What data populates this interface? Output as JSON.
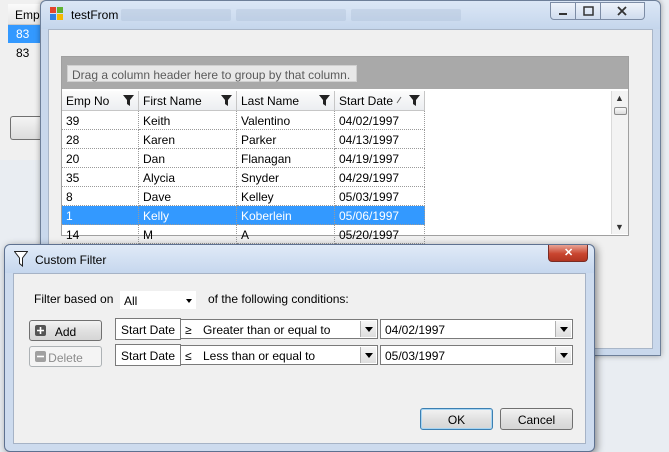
{
  "background_window": {
    "header": "Emp",
    "rows": [
      "83",
      "83"
    ]
  },
  "main_window": {
    "title": "testFrom",
    "grid": {
      "group_hint": "Drag a column header here to group by that column.",
      "columns": [
        "Emp No",
        "First Name",
        "Last Name",
        "Start Date"
      ],
      "rows": [
        [
          "39",
          "Keith",
          "Valentino",
          "04/02/1997"
        ],
        [
          "28",
          "Karen",
          "Parker",
          "04/13/1997"
        ],
        [
          "20",
          "Dan",
          "Flanagan",
          "04/19/1997"
        ],
        [
          "35",
          "Alycia",
          "Snyder",
          "04/29/1997"
        ],
        [
          "8",
          "Dave",
          "Kelley",
          "05/03/1997"
        ],
        [
          "1",
          "Kelly",
          "Koberlein",
          "05/06/1997"
        ],
        [
          "14",
          "M",
          "A",
          "05/20/1997"
        ]
      ],
      "selected_row": 5
    }
  },
  "custom_filter": {
    "title": "Custom Filter",
    "filter_based_on_label": "Filter based on",
    "filter_based_on_value": "All",
    "conditions_label": "of the following conditions:",
    "add_label": "Add",
    "delete_label": "Delete",
    "conditions": [
      {
        "field": "Start Date",
        "symbol": "≥",
        "operator": "Greater than or equal to",
        "value": "04/02/1997"
      },
      {
        "field": "Start Date",
        "symbol": "≤",
        "operator": "Less than or equal to",
        "value": "05/03/1997"
      }
    ],
    "ok_label": "OK",
    "cancel_label": "Cancel"
  },
  "colors": {
    "selection": "#3399ff",
    "group_panel": "#a9a9a9",
    "close_button": "#c9452f"
  }
}
